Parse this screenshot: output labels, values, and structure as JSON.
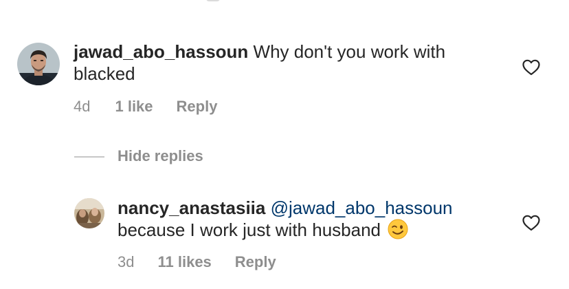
{
  "comments": [
    {
      "username": "jawad_abo_hassoun",
      "text_line1": " Why don't you work with",
      "text_line2": "blacked",
      "time": "4d",
      "likes": "1 like",
      "reply_label": "Reply",
      "avatar_icon": "avatar-photo-man"
    },
    {
      "username": "nancy_anastasiia",
      "mention": "@jawad_abo_hassoun",
      "text_line2": "because I work just with husband",
      "emoji": "winking-face",
      "time": "3d",
      "likes": "11 likes",
      "reply_label": "Reply",
      "avatar_icon": "avatar-photo-woman"
    }
  ],
  "replies_toggle": {
    "label": "Hide replies"
  },
  "icons": {
    "like": "heart-outline-icon"
  },
  "colors": {
    "text": "#262626",
    "meta": "#8e8e8e",
    "mention": "#00376b"
  }
}
